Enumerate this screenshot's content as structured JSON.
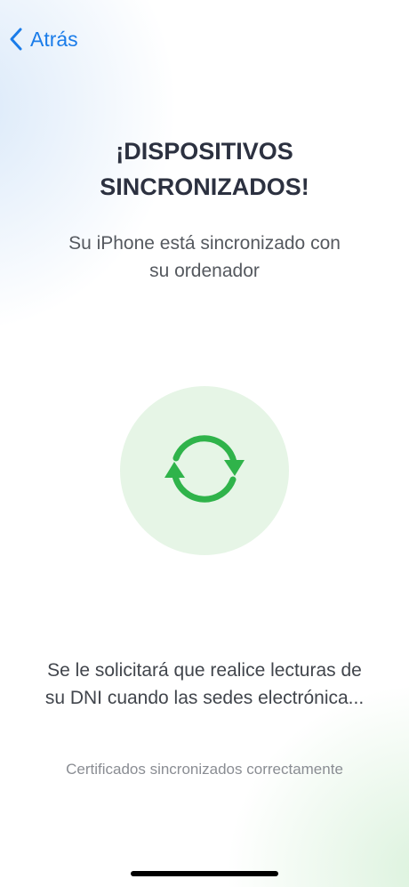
{
  "nav": {
    "back_label": "Atrás",
    "back_icon": "chevron-left-icon"
  },
  "title_lines": [
    "¡DISPOSITIVOS",
    "SINCRONIZADOS!"
  ],
  "subtitle_lines": [
    "Su iPhone está sincronizado con",
    "su ordenador"
  ],
  "sync": {
    "icon": "sync-arrows-icon",
    "color": "#2fb34a",
    "circle_color": "#e6f5e6"
  },
  "info_lines": [
    "Se le solicitará que realice lecturas de",
    "su DNI cuando las sedes electrónica..."
  ],
  "status": "Certificados sincronizados correctamente"
}
